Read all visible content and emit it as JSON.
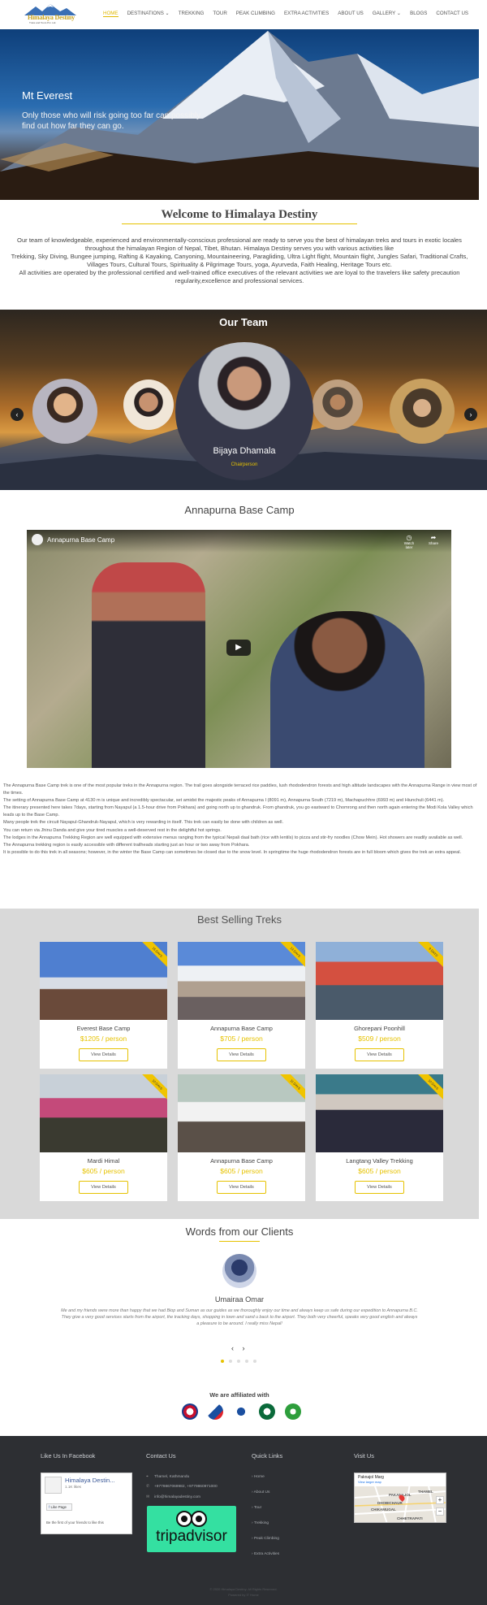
{
  "header": {
    "logo_text": "Himalaya Destiny",
    "logo_sub": "Treks and Tours Pvt. Ltd.",
    "nav": [
      {
        "label": "HOME",
        "active": true
      },
      {
        "label": "DESTINATIONS ⌄"
      },
      {
        "label": "TREKKING"
      },
      {
        "label": "TOUR"
      },
      {
        "label": "PEAK CLIMBING"
      },
      {
        "label": "EXTRA ACTIVITIES"
      },
      {
        "label": "ABOUT US"
      },
      {
        "label": "GALLERY ⌄"
      },
      {
        "label": "BLOGS"
      },
      {
        "label": "CONTACT US"
      }
    ]
  },
  "hero": {
    "title": "Mt Everest",
    "subtitle": "Only those who will risk going too far can possibly find out how far they can go."
  },
  "welcome": {
    "title": "Welcome to Himalaya Destiny",
    "p1": "Our team of knowledgeable, experienced and environmentally-conscious professional are ready to serve you the best of himalayan treks and tours in exotic locales throughout the himalayan Region of Nepal, Tibet, Bhutan. Himalaya Destiny serves you with various activities like",
    "p2": "Trekking, Sky Diving, Bungee jumping, Rafting & Kayaking, Canyoning, Mountaineering, Paragliding, Ultra Light flight, Mountain flight, Jungles Safari, Traditional Crafts, Villages Tours, Cultural Tours, Spirituality & Pilgrimage Tours, yoga, Ayurveda, Faith Healing, Heritage Tours etc.",
    "p3": "All activities are operated by the professional certified and well-trained office executives of the relevant activities we are loyal to the travelers like safety precaution regularity,excellence and professional services."
  },
  "team": {
    "title": "Our Team",
    "member_name": "Bijaya Dhamala",
    "member_role": "Chairperson",
    "prev": "‹",
    "next": "›"
  },
  "abc": {
    "title": "Annapurna Base Camp",
    "video_title": "Annapurna Base Camp",
    "watch_later": "Watch later",
    "share": "Share",
    "paragraphs": [
      "The Annapurna Base Camp trek is one of the most popular treks in the Annapurna region. The trail goes alongside terraced rice paddies, lush rhododendron forests and high altitude landscapes with the Annapurna Range in view most of the times.",
      "The setting of Annapurna Base Camp at 4130 m is unique and incredibly spectacular, set amidst the majestic peaks of Annapurna I (8091 m), Annapurna South (7219 m), Machapuchhre (6993 m) and Hiunchuli (6441 m).",
      "The itinerary presented here takes 7days, starting from Nayapul (a 1.5-hour drive from Pokhara) and going north up to ghandruk. From ghandruk, you go eastward to Chomrong and then north again entering the Modi Kola Valley which leads up to the Base Camp.",
      "Many people trek the circuit Nayapul-Ghandruk-Nayapul, which is very rewarding in itself. This trek can easily be done with children as well.",
      "You can return via Jhinu Danda and give your tired muscles a well-deserved rest in the delightful hot springs.",
      "The lodges in the Annapurna Trekking Region are well equipped with extensive menus ranging from the typical Nepali daal bath (rice with lentils) to pizza and stir-fry noodles (Chow Mein). Hot showers are readily available as well.",
      "The Annapurna trekking region is easily accessible with different trailheads starting just an hour or two away from Pokhara.",
      "It is possible to do this trek in all seasons; however, in the winter the Base Camp can sometimes be closed due to the snow level. In springtime the huge rhododendron forests are in full bloom which gives the trek an extra appeal."
    ]
  },
  "best": {
    "title": "Best Selling Treks",
    "button": "View Details",
    "treks": [
      {
        "name": "Everest Base Camp",
        "price": "$1205 / person",
        "days": "15 DAYS"
      },
      {
        "name": "Annapurna Base Camp",
        "price": "$705 / person",
        "days": "13 DAYS"
      },
      {
        "name": "Ghorepani Poonhill",
        "price": "$509 / person",
        "days": "9 DAYS"
      },
      {
        "name": "Mardi Himal",
        "price": "$605 / person",
        "days": "10 DAYS"
      },
      {
        "name": "Annapurna Base Camp",
        "price": "$605 / person",
        "days": "11 DAYS"
      },
      {
        "name": "Langtang Valley Trekking",
        "price": "$605 / person",
        "days": "10 DAYS"
      }
    ]
  },
  "words": {
    "title": "Words from our Clients",
    "client_name": "Umairaa Omar",
    "quote": "Me and my friends were more than happy that we had Biop and Suman as our guides as we thoroughly enjoy our time and always keep us safe during our expedition to Annapurna B.C. They give a very good services starts from the airport, the tracking days, shopping in town and sand u back to the airport. They both very cheerful, speaks very good english and always a pleasure to be around. I really miss Nepal!",
    "prev": "‹",
    "next": "›"
  },
  "affiliations": {
    "title": "We are affiliated with"
  },
  "footer": {
    "facebook_heading": "Like Us In Facebook",
    "fb_page": "Himalaya Destin...",
    "fb_likes": "1.1K likes",
    "fb_like_btn": "Like Page",
    "fb_first": "Be the first of your friends to like this",
    "contact_heading": "Contact Us",
    "address": "Thamel, Kathmandu",
    "phone": "+9779867069982, +9779860971000",
    "email": "info@himalayadestiny.com",
    "tripadvisor": "tripadvisor",
    "quick_heading": "Quick Links",
    "quick_links": [
      "Home",
      "About Us",
      "Tour",
      "Trekking",
      "Peak Climbing",
      "Extra Activities"
    ],
    "visit_heading": "Visit Us",
    "map_place": "Paknajol Marg",
    "map_link": "View larger map",
    "map_labels": [
      "PAKANAJOL",
      "THAMEL",
      "DHOBICHAUR",
      "CHIKAMUGAL",
      "CHHETRAPATI"
    ],
    "copyright": "© 2020 Himalaya Destiny. All Rights Reserved.",
    "powered": "Powered by IT Home"
  }
}
